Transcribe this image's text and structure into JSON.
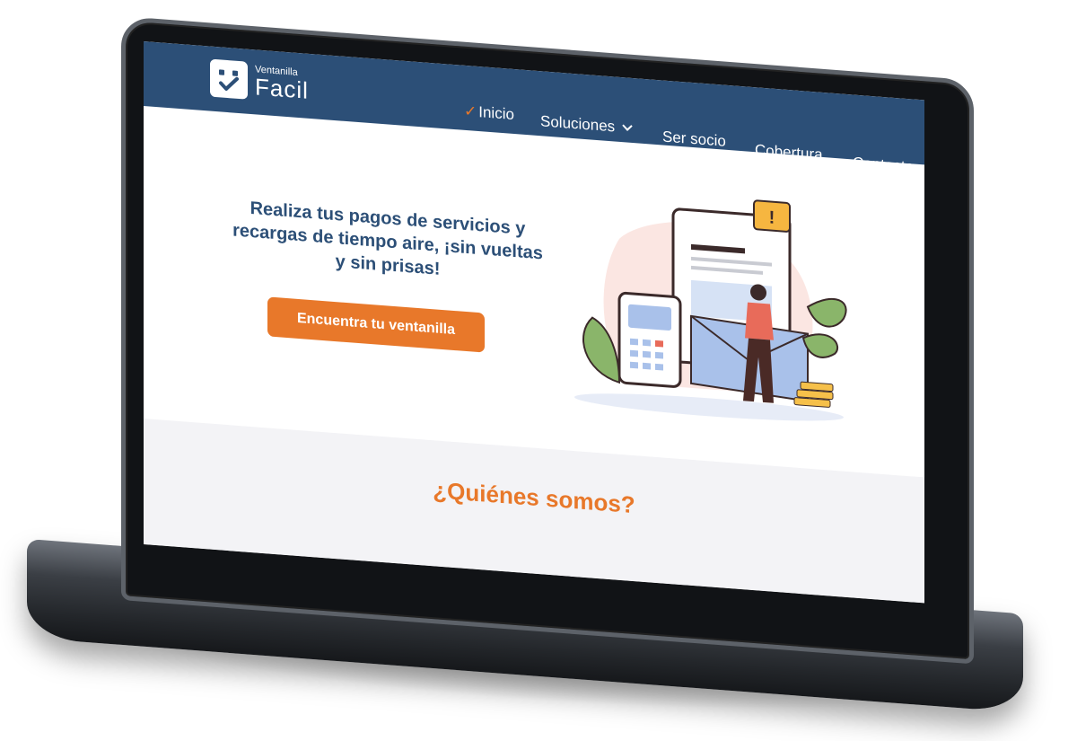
{
  "brand": {
    "small": "Ventanilla",
    "big": "Facil"
  },
  "nav": {
    "items": [
      {
        "label": "Inicio",
        "active": true
      },
      {
        "label": "Soluciones",
        "has_dropdown": true
      },
      {
        "label": "Ser socio"
      },
      {
        "label": "Cobertura"
      },
      {
        "label": "Contacto"
      }
    ]
  },
  "hero": {
    "title": "Realiza tus pagos de servicios y recargas de tiempo aire, ¡sin vueltas y sin prisas!",
    "cta_label": "Encuentra tu ventanilla"
  },
  "about": {
    "title": "¿Quiénes somos?"
  },
  "colors": {
    "nav_bg": "#2c4f77",
    "accent": "#e8782a",
    "title": "#2c4f77",
    "section_bg": "#f3f3f6"
  },
  "icons": [
    "check-icon",
    "chevron-down-icon",
    "logo-smile-icon"
  ]
}
